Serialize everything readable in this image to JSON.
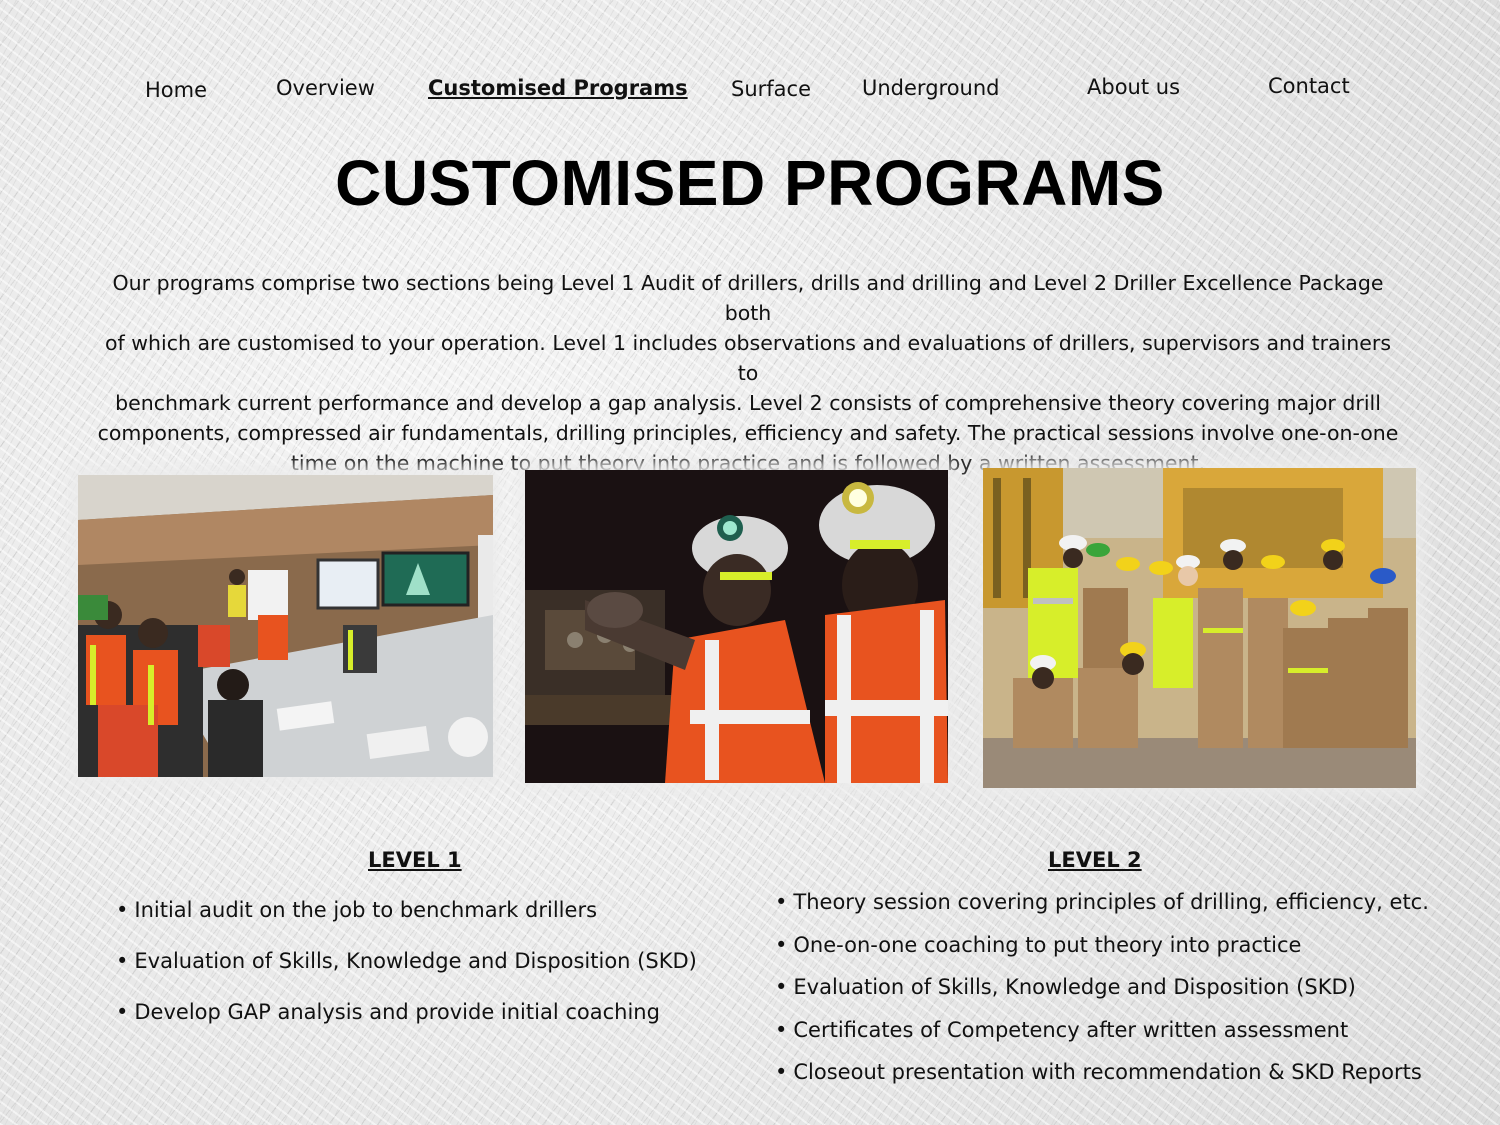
{
  "nav": {
    "items": [
      {
        "label": "Home"
      },
      {
        "label": "Overview"
      },
      {
        "label": "Customised Programs",
        "active": true
      },
      {
        "label": "Surface"
      },
      {
        "label": "Underground"
      },
      {
        "label": "About us"
      },
      {
        "label": "Contact"
      }
    ]
  },
  "page": {
    "title": "CUSTOMISED PROGRAMS",
    "intro_lines": [
      "Our programs comprise two sections being Level 1 Audit of drillers, drills and drilling and Level 2 Driller Excellence Package both",
      "of which are customised to your operation. Level 1 includes observations and evaluations of drillers, supervisors and trainers to",
      "benchmark current performance and develop a gap analysis. Level 2 consists of comprehensive theory covering major drill",
      "components, compressed air fundamentals, drilling principles, efficiency and safety. The practical sessions involve one-on-one",
      "time on the machine to put theory into practice and is followed by a written assessment."
    ]
  },
  "photos": [
    {
      "subject": "classroom training session"
    },
    {
      "subject": "underground drillers at controls"
    },
    {
      "subject": "drill crew group photo"
    }
  ],
  "level1": {
    "heading": "LEVEL 1",
    "bullet": "•",
    "items": [
      "Initial audit on the job to benchmark drillers",
      "Evaluation of Skills, Knowledge and Disposition (SKD)",
      "Develop GAP analysis and provide initial coaching"
    ]
  },
  "level2": {
    "heading": "LEVEL 2",
    "bullet": "•",
    "items": [
      "Theory session covering principles of drilling, efficiency, etc.",
      "One-on-one coaching to put theory into practice",
      "Evaluation of Skills, Knowledge and Disposition (SKD)",
      "Certificates of Competency after written assessment",
      "Closeout presentation with recommendation & SKD Reports"
    ]
  },
  "colors": {
    "text": "#111111",
    "hi_vis_orange": "#e8531f",
    "hi_vis_yellow": "#d7ee2a",
    "machine_yellow": "#d9a73a"
  }
}
